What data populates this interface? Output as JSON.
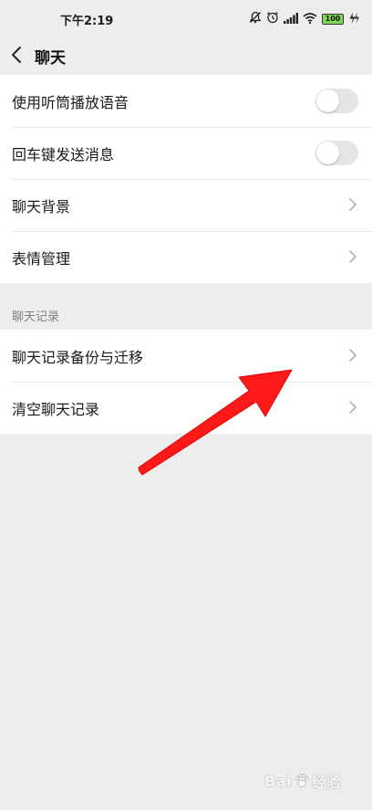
{
  "status_bar": {
    "time": "下午2:19",
    "battery_level": "100",
    "icons": [
      "mute-icon",
      "alarm-icon",
      "signal-icon",
      "wifi-icon",
      "battery-icon",
      "charging-icon"
    ]
  },
  "header": {
    "title": "聊天",
    "back_icon": "chevron-left-icon"
  },
  "settings_group": {
    "items": [
      {
        "label": "使用听筒播放语音",
        "type": "toggle",
        "enabled": false
      },
      {
        "label": "回车键发送消息",
        "type": "toggle",
        "enabled": false
      },
      {
        "label": "聊天背景",
        "type": "link"
      },
      {
        "label": "表情管理",
        "type": "link"
      }
    ]
  },
  "history_section": {
    "title": "聊天记录",
    "items": [
      {
        "label": "聊天记录备份与迁移",
        "type": "link"
      },
      {
        "label": "清空聊天记录",
        "type": "link"
      }
    ]
  },
  "annotation": {
    "arrow_color": "#ff1a1a",
    "points_to": "聊天记录备份与迁移"
  },
  "watermark": {
    "text": "Bai",
    "text_suffix": "经验"
  },
  "colors": {
    "background": "#ededed",
    "card": "#ffffff",
    "divider": "#e7e7e7",
    "section_label": "#7f7f7f",
    "toggle_off": "#e5e5e5"
  }
}
